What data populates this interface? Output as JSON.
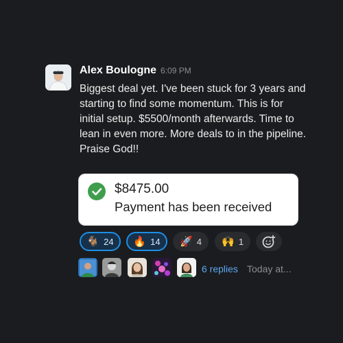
{
  "message": {
    "author": "Alex Boulogne",
    "timestamp": "6:09 PM",
    "text": "Biggest deal yet. I've been stuck for 3 years and starting to find some momentum. This is for initial setup. $5500/month afterwards. Time to lean in even more. More deals to in the pipeline. Praise God!!"
  },
  "payment_card": {
    "amount": "$8475.00",
    "status": "Payment has been received",
    "icon": "check-circle-icon",
    "accent": "#3f9e4c"
  },
  "reactions": [
    {
      "emoji": "🐐",
      "count": "24",
      "active": true
    },
    {
      "emoji": "🔥",
      "count": "14",
      "active": true
    },
    {
      "emoji": "🚀",
      "count": "4",
      "active": false
    },
    {
      "emoji": "🙌",
      "count": "1",
      "active": false
    }
  ],
  "add_reaction_icon": "add-emoji-icon",
  "thread": {
    "replies": "6 replies",
    "last_reply": "Today at..."
  },
  "colors": {
    "background": "#1b1c1f",
    "link": "#5aa7f0",
    "active_reaction_border": "#1d8fe6"
  }
}
